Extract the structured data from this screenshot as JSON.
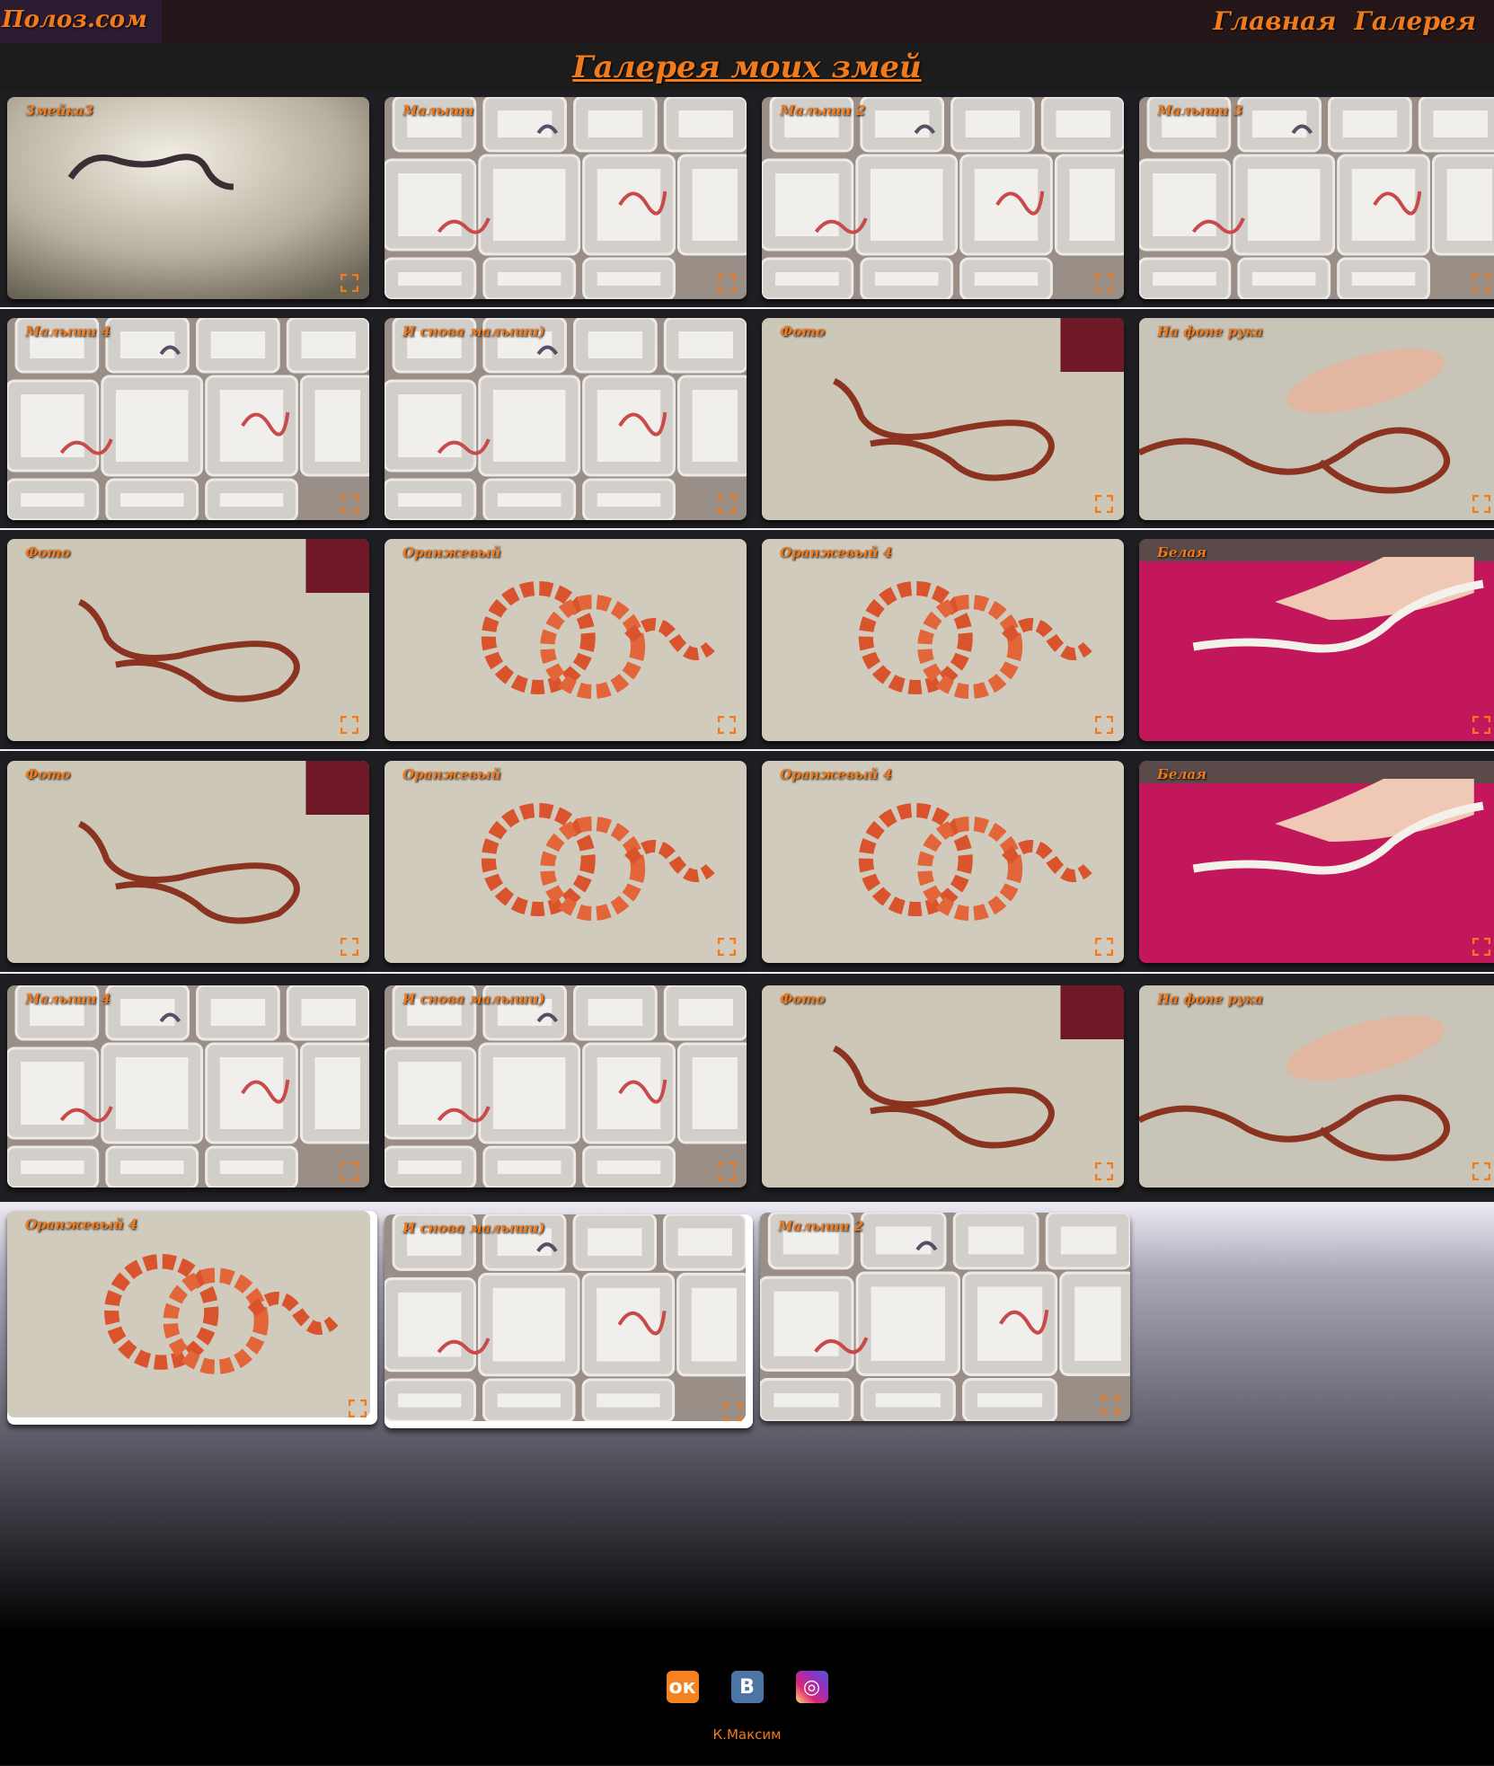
{
  "header": {
    "logo": "Полоз.сом",
    "nav": [
      "Главная",
      "Галерея"
    ]
  },
  "page_title": "Галерея моих змей",
  "gallery": [
    {
      "label": "Змейка3",
      "scene": "carpet-dark"
    },
    {
      "label": "Малыши",
      "scene": "boxes"
    },
    {
      "label": "Малыши 2",
      "scene": "boxes"
    },
    {
      "label": "Малыши 3",
      "scene": "boxes"
    },
    {
      "label": "Малыши 4",
      "scene": "boxes"
    },
    {
      "label": "И снова малыши)",
      "scene": "boxes"
    },
    {
      "label": "Фото",
      "scene": "carpet-red"
    },
    {
      "label": "На фоне рука",
      "scene": "carpet-hand"
    },
    {
      "label": "Фото",
      "scene": "carpet-red"
    },
    {
      "label": "Оранжевый",
      "scene": "carpet-orange"
    },
    {
      "label": "Оранжевый 4",
      "scene": "carpet-orange"
    },
    {
      "label": "Белая",
      "scene": "pink-white"
    },
    {
      "label": "Фото",
      "scene": "carpet-red"
    },
    {
      "label": "Оранжевый",
      "scene": "carpet-orange"
    },
    {
      "label": "Оранжевый 4",
      "scene": "carpet-orange"
    },
    {
      "label": "Белая",
      "scene": "pink-white"
    },
    {
      "label": "Малыши 4",
      "scene": "boxes"
    },
    {
      "label": "И снова малыши)",
      "scene": "boxes"
    },
    {
      "label": "Фото",
      "scene": "carpet-red"
    },
    {
      "label": "На фоне рука",
      "scene": "carpet-hand"
    },
    {
      "label": "Оранжевый 4",
      "scene": "carpet-orange"
    },
    {
      "label": "И снова малыши)",
      "scene": "boxes"
    },
    {
      "label": "Малыши 2",
      "scene": "boxes"
    }
  ],
  "footer": {
    "social": [
      {
        "name": "odnoklassniki",
        "glyph": "ок",
        "color": "#f58220"
      },
      {
        "name": "vkontakte",
        "glyph": "В",
        "color": "#4c75a3"
      },
      {
        "name": "instagram",
        "glyph": "◎",
        "color": "#c13584"
      }
    ],
    "author": "К.Максим"
  },
  "colors": {
    "accent": "#f07a1c",
    "topbar": "#231719"
  }
}
